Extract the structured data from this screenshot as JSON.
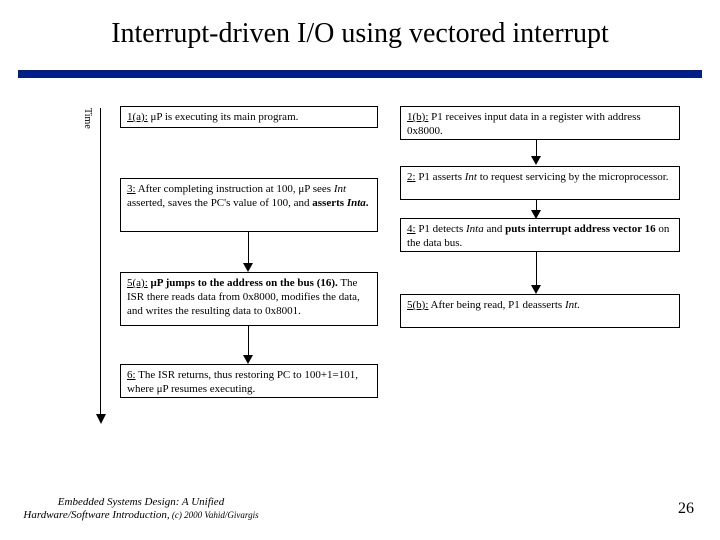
{
  "title": "Interrupt-driven I/O using vectored interrupt",
  "time_label": "Time",
  "boxes": {
    "b1a": {
      "label": "1(a):",
      "text": " μP is executing its main program."
    },
    "b1b": {
      "label": "1(b):",
      "text": " P1 receives input data in a register with address 0x8000."
    },
    "b2": {
      "label": "2:",
      "text_pre": " P1 asserts ",
      "ital": "Int",
      "text_post": " to request servicing by the microprocessor."
    },
    "b3": {
      "label": "3:",
      "text_pre": " After completing instruction at 100, μP sees ",
      "ital": "Int",
      "text_mid": " asserted, saves the PC's value of 100, and ",
      "bold1": "asserts ",
      "bold_ital": "Inta",
      "bold2": "."
    },
    "b4": {
      "label": "4:",
      "text_pre": " P1 detects ",
      "ital": "Inta",
      "text_mid": " and ",
      "bold": "puts interrupt address vector 16",
      "text_post": " on the data bus."
    },
    "b5a": {
      "label": "5(a):",
      "bold": " μP jumps to the address on the bus (16).",
      "text": " The ISR there reads data from 0x8000, modifies the data, and writes the resulting data to 0x8001."
    },
    "b5b": {
      "label": "5(b):",
      "text_pre": " After being read, P1 deasserts ",
      "ital": "Int",
      "text_post": "."
    },
    "b6": {
      "label": "6:",
      "text": " The ISR returns, thus restoring PC to 100+1=101, where μP resumes executing."
    }
  },
  "footer": {
    "book": "Embedded Systems Design: A Unified Hardware/Software Introduction,",
    "copyright": " (c) 2000 Vahid/Givargis",
    "page": "26"
  }
}
